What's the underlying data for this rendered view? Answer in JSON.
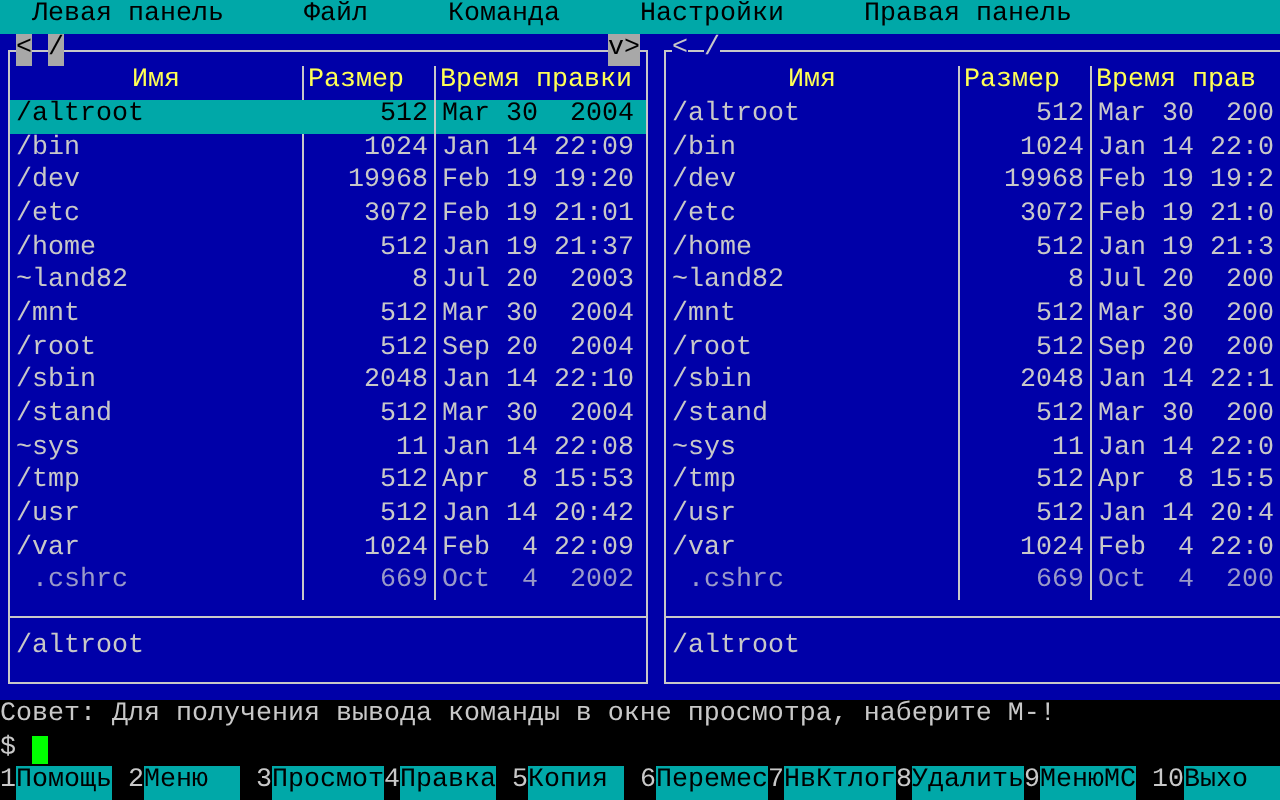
{
  "menu": [
    "Левая панель",
    "Файл",
    "Команда",
    "Настройки",
    "Правая панель"
  ],
  "panels": [
    {
      "active": true,
      "back": "<",
      "path": "/",
      "more": "v>",
      "columns": [
        "Имя",
        "Размер",
        "Время правки"
      ],
      "status": "/altroot",
      "rows": [
        {
          "kind": "dir",
          "name": "/altroot",
          "size": "512",
          "modified": "Mar 30  2004",
          "selected": true
        },
        {
          "kind": "dir",
          "name": "/bin",
          "size": "1024",
          "modified": "Jan 14 22:09",
          "selected": false
        },
        {
          "kind": "dir",
          "name": "/dev",
          "size": "19968",
          "modified": "Feb 19 19:20",
          "selected": false
        },
        {
          "kind": "dir",
          "name": "/etc",
          "size": "3072",
          "modified": "Feb 19 21:01",
          "selected": false
        },
        {
          "kind": "dir",
          "name": "/home",
          "size": "512",
          "modified": "Jan 19 21:37",
          "selected": false
        },
        {
          "kind": "dir",
          "name": "~land82",
          "size": "8",
          "modified": "Jul 20  2003",
          "selected": false
        },
        {
          "kind": "dir",
          "name": "/mnt",
          "size": "512",
          "modified": "Mar 30  2004",
          "selected": false
        },
        {
          "kind": "dir",
          "name": "/root",
          "size": "512",
          "modified": "Sep 20  2004",
          "selected": false
        },
        {
          "kind": "dir",
          "name": "/sbin",
          "size": "2048",
          "modified": "Jan 14 22:10",
          "selected": false
        },
        {
          "kind": "dir",
          "name": "/stand",
          "size": "512",
          "modified": "Mar 30  2004",
          "selected": false
        },
        {
          "kind": "dir",
          "name": "~sys",
          "size": "11",
          "modified": "Jan 14 22:08",
          "selected": false
        },
        {
          "kind": "dir",
          "name": "/tmp",
          "size": "512",
          "modified": "Apr  8 15:53",
          "selected": false
        },
        {
          "kind": "dir",
          "name": "/usr",
          "size": "512",
          "modified": "Jan 14 20:42",
          "selected": false
        },
        {
          "kind": "dir",
          "name": "/var",
          "size": "1024",
          "modified": "Feb  4 22:09",
          "selected": false
        },
        {
          "kind": "file",
          "name": ".cshrc",
          "size": "669",
          "modified": "Oct  4  2002",
          "selected": false
        }
      ]
    },
    {
      "active": false,
      "back": "<",
      "path": "/",
      "columns": [
        "Имя",
        "Размер",
        "Время прав"
      ],
      "status": "/altroot",
      "rows": [
        {
          "kind": "dir",
          "name": "/altroot",
          "size": "512",
          "modified": "Mar 30  200",
          "selected": false
        },
        {
          "kind": "dir",
          "name": "/bin",
          "size": "1024",
          "modified": "Jan 14 22:0",
          "selected": false
        },
        {
          "kind": "dir",
          "name": "/dev",
          "size": "19968",
          "modified": "Feb 19 19:2",
          "selected": false
        },
        {
          "kind": "dir",
          "name": "/etc",
          "size": "3072",
          "modified": "Feb 19 21:0",
          "selected": false
        },
        {
          "kind": "dir",
          "name": "/home",
          "size": "512",
          "modified": "Jan 19 21:3",
          "selected": false
        },
        {
          "kind": "dir",
          "name": "~land82",
          "size": "8",
          "modified": "Jul 20  200",
          "selected": false
        },
        {
          "kind": "dir",
          "name": "/mnt",
          "size": "512",
          "modified": "Mar 30  200",
          "selected": false
        },
        {
          "kind": "dir",
          "name": "/root",
          "size": "512",
          "modified": "Sep 20  200",
          "selected": false
        },
        {
          "kind": "dir",
          "name": "/sbin",
          "size": "2048",
          "modified": "Jan 14 22:1",
          "selected": false
        },
        {
          "kind": "dir",
          "name": "/stand",
          "size": "512",
          "modified": "Mar 30  200",
          "selected": false
        },
        {
          "kind": "dir",
          "name": "~sys",
          "size": "11",
          "modified": "Jan 14 22:0",
          "selected": false
        },
        {
          "kind": "dir",
          "name": "/tmp",
          "size": "512",
          "modified": "Apr  8 15:5",
          "selected": false
        },
        {
          "kind": "dir",
          "name": "/usr",
          "size": "512",
          "modified": "Jan 14 20:4",
          "selected": false
        },
        {
          "kind": "dir",
          "name": "/var",
          "size": "1024",
          "modified": "Feb  4 22:0",
          "selected": false
        },
        {
          "kind": "file",
          "name": ".cshrc",
          "size": "669",
          "modified": "Oct  4  200",
          "selected": false
        }
      ]
    }
  ],
  "hint": "Совет: Для получения вывода команды в окне просмотра, наберите M-!",
  "prompt": "$",
  "keybar": [
    {
      "key": "1",
      "label": "Помощь"
    },
    {
      "key": "2",
      "label": "Меню"
    },
    {
      "key": "3",
      "label": "Просмот"
    },
    {
      "key": "4",
      "label": "Правка"
    },
    {
      "key": "5",
      "label": "Копия"
    },
    {
      "key": "6",
      "label": "Перемес"
    },
    {
      "key": "7",
      "label": "НвКтлог"
    },
    {
      "key": "8",
      "label": "Удалить"
    },
    {
      "key": "9",
      "label": "МенюМС"
    },
    {
      "key": "10",
      "label": "Выхо"
    }
  ]
}
